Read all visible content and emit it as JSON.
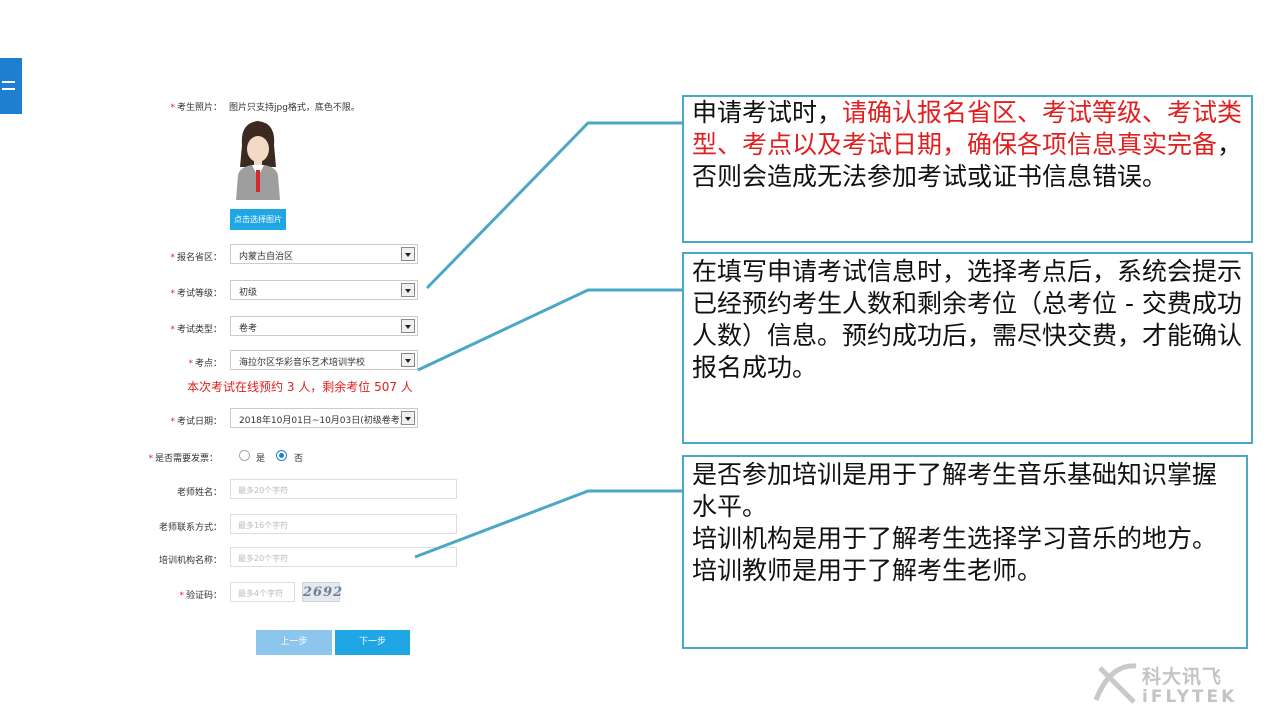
{
  "form": {
    "photo_label": "考生照片：",
    "photo_hint": "图片只支持jpg格式，底色不限。",
    "pick_photo_button": "点击选择图片",
    "province_label": "报名省区：",
    "province_value": "内蒙古自治区",
    "level_label": "考试等级：",
    "level_value": "初级",
    "type_label": "考试类型：",
    "type_value": "卷考",
    "site_label": "考点：",
    "site_value": "海拉尔区华彩音乐艺术培训学校",
    "booking_notice": "本次考试在线预约 3 人，剩余考位 507 人",
    "date_label": "考试日期：",
    "date_value": "2018年10月01日~10月03日(初级卷考)",
    "invoice_label": "是否需要发票：",
    "invoice_yes": "是",
    "invoice_no": "否",
    "invoice_selected": "否",
    "teacher_name_label": "老师姓名：",
    "teacher_name_placeholder": "最多20个字符",
    "teacher_contact_label": "老师联系方式：",
    "teacher_contact_placeholder": "最多16个字符",
    "training_org_label": "培训机构名称：",
    "training_org_placeholder": "最多20个字符",
    "captcha_label": "验证码：",
    "captcha_placeholder": "最多4个字符",
    "captcha_text": "2692",
    "prev_button": "上一步",
    "next_button": "下一步"
  },
  "callouts": {
    "first": {
      "part1": "申请考试时，",
      "part2_red": "请确认报名省区、考试等级、考试类型、考点以及考试日期，确保各项信息真实完备",
      "part3": "，否则会造成无法参加考试或证书信息错误。"
    },
    "second": "在填写申请考试信息时，选择考点后，系统会提示已经预约考生人数和剩余考位（总考位 - 交费成功人数）信息。预约成功后，需尽快交费，才能确认报名成功。",
    "third_lines": [
      "是否参加培训是用于了解考生音乐基础知识掌握水平。",
      "培训机构是用于了解考生选择学习音乐的地方。",
      "培训教师是用于了解考生老师。"
    ]
  },
  "logo": {
    "cn": "科大讯飞",
    "en": "iFLYTEK"
  },
  "colors": {
    "accent_blue": "#1e7fd1",
    "required_red": "#e02020",
    "callout_border": "#4aa8c6",
    "button_blue": "#1fa6e4"
  }
}
